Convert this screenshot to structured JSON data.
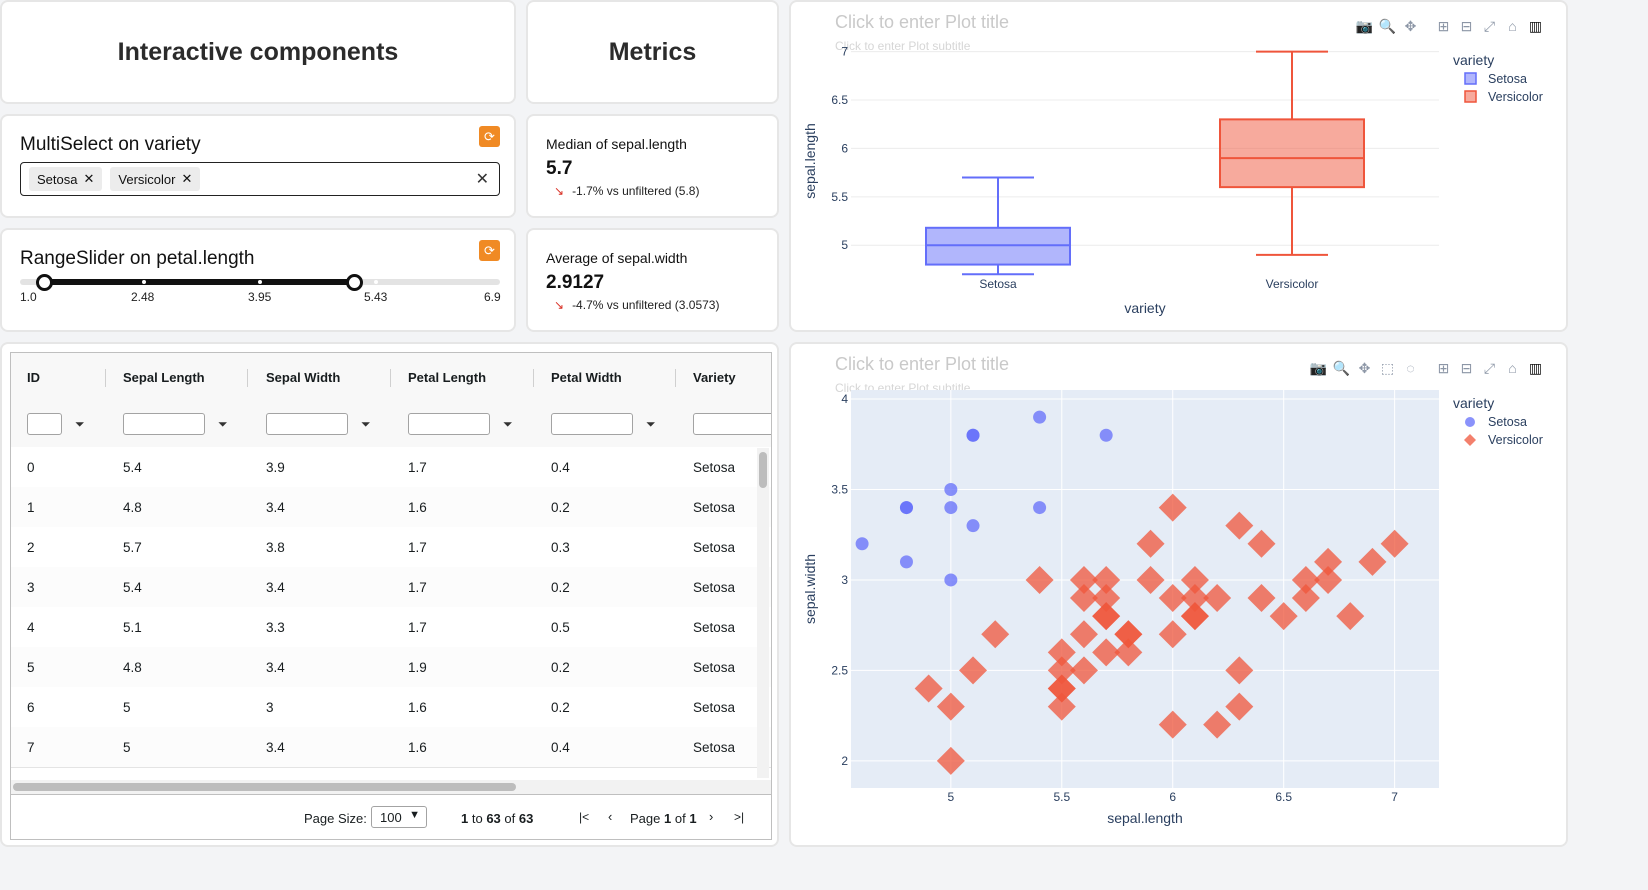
{
  "headers": {
    "interactive": "Interactive components",
    "metrics": "Metrics"
  },
  "multiselect": {
    "title": "MultiSelect on variety",
    "chips": [
      "Setosa",
      "Versicolor"
    ]
  },
  "rangeslider": {
    "title": "RangeSlider on petal.length",
    "min": 1.0,
    "max": 6.9,
    "value": [
      1.3,
      5.1
    ],
    "labels": [
      "1.0",
      "2.48",
      "3.95",
      "5.43",
      "6.9"
    ]
  },
  "metric1": {
    "label": "Median of sepal.length",
    "value": "5.7",
    "delta": "-1.7% vs unfiltered (5.8)"
  },
  "metric2": {
    "label": "Average of sepal.width",
    "value": "2.9127",
    "delta": "-4.7% vs unfiltered (3.0573)"
  },
  "table": {
    "columns": [
      "ID",
      "Sepal Length",
      "Sepal Width",
      "Petal Length",
      "Petal Width",
      "Variety"
    ],
    "rows": [
      [
        "0",
        "5.4",
        "3.9",
        "1.7",
        "0.4",
        "Setosa"
      ],
      [
        "1",
        "4.8",
        "3.4",
        "1.6",
        "0.2",
        "Setosa"
      ],
      [
        "2",
        "5.7",
        "3.8",
        "1.7",
        "0.3",
        "Setosa"
      ],
      [
        "3",
        "5.4",
        "3.4",
        "1.7",
        "0.2",
        "Setosa"
      ],
      [
        "4",
        "5.1",
        "3.3",
        "1.7",
        "0.5",
        "Setosa"
      ],
      [
        "5",
        "4.8",
        "3.4",
        "1.9",
        "0.2",
        "Setosa"
      ],
      [
        "6",
        "5",
        "3",
        "1.6",
        "0.2",
        "Setosa"
      ],
      [
        "7",
        "5",
        "3.4",
        "1.6",
        "0.4",
        "Setosa"
      ]
    ],
    "page_size_label": "Page Size:",
    "page_size": "100",
    "range_from": "1",
    "range_to_word": "to",
    "range_to": "63",
    "of_word": "of",
    "total": "63",
    "page_word": "Page",
    "page": "1",
    "pages": "1"
  },
  "plot_placeholders": {
    "title": "Click to enter Plot title",
    "subtitle": "Click to enter Plot subtitle"
  },
  "chart_data": [
    {
      "type": "box",
      "xlabel": "variety",
      "ylabel": "sepal.length",
      "legend_title": "variety",
      "legend_position": "top-right",
      "ylim": [
        4.62,
        7.12
      ],
      "yticks": [
        5,
        5.5,
        6,
        6.5,
        7
      ],
      "series": [
        {
          "name": "Setosa",
          "color": "#636efa",
          "min": 4.7,
          "q1": 4.8,
          "median": 5.0,
          "q3": 5.18,
          "max": 5.7
        },
        {
          "name": "Versicolor",
          "color": "#ef553b",
          "min": 4.9,
          "q1": 5.6,
          "median": 5.9,
          "q3": 6.3,
          "max": 7.0
        }
      ]
    },
    {
      "type": "scatter",
      "xlabel": "sepal.length",
      "ylabel": "sepal.width",
      "legend_title": "variety",
      "legend_position": "top-right",
      "xlim": [
        4.55,
        7.2
      ],
      "ylim": [
        1.85,
        4.05
      ],
      "xticks": [
        5,
        5.5,
        6,
        6.5,
        7
      ],
      "yticks": [
        2,
        2.5,
        3,
        3.5,
        4
      ],
      "series": [
        {
          "name": "Setosa",
          "color": "#636efa",
          "marker": "circle",
          "points": [
            [
              4.6,
              3.2
            ],
            [
              4.8,
              3.4
            ],
            [
              4.8,
              3.4
            ],
            [
              4.8,
              3.1
            ],
            [
              5.0,
              3.5
            ],
            [
              5.0,
              3.4
            ],
            [
              5.0,
              3.0
            ],
            [
              5.1,
              3.8
            ],
            [
              5.1,
              3.8
            ],
            [
              5.1,
              3.3
            ],
            [
              5.4,
              3.9
            ],
            [
              5.4,
              3.4
            ],
            [
              5.7,
              3.8
            ]
          ]
        },
        {
          "name": "Versicolor",
          "color": "#ef553b",
          "marker": "diamond",
          "points": [
            [
              4.9,
              2.4
            ],
            [
              5.0,
              2.3
            ],
            [
              5.0,
              2.0
            ],
            [
              5.1,
              2.5
            ],
            [
              5.2,
              2.7
            ],
            [
              5.4,
              3.0
            ],
            [
              5.5,
              2.6
            ],
            [
              5.5,
              2.5
            ],
            [
              5.5,
              2.4
            ],
            [
              5.5,
              2.4
            ],
            [
              5.5,
              2.3
            ],
            [
              5.6,
              3.0
            ],
            [
              5.6,
              2.9
            ],
            [
              5.6,
              2.7
            ],
            [
              5.6,
              2.5
            ],
            [
              5.7,
              3.0
            ],
            [
              5.7,
              2.9
            ],
            [
              5.7,
              2.8
            ],
            [
              5.7,
              2.8
            ],
            [
              5.7,
              2.6
            ],
            [
              5.8,
              2.7
            ],
            [
              5.8,
              2.7
            ],
            [
              5.8,
              2.6
            ],
            [
              5.9,
              3.2
            ],
            [
              5.9,
              3.0
            ],
            [
              6.0,
              3.4
            ],
            [
              6.0,
              2.9
            ],
            [
              6.0,
              2.7
            ],
            [
              6.0,
              2.2
            ],
            [
              6.1,
              3.0
            ],
            [
              6.1,
              2.9
            ],
            [
              6.1,
              2.8
            ],
            [
              6.1,
              2.8
            ],
            [
              6.2,
              2.9
            ],
            [
              6.2,
              2.2
            ],
            [
              6.3,
              3.3
            ],
            [
              6.3,
              2.5
            ],
            [
              6.3,
              2.3
            ],
            [
              6.4,
              3.2
            ],
            [
              6.4,
              2.9
            ],
            [
              6.5,
              2.8
            ],
            [
              6.6,
              3.0
            ],
            [
              6.6,
              2.9
            ],
            [
              6.7,
              3.1
            ],
            [
              6.7,
              3.0
            ],
            [
              6.8,
              2.8
            ],
            [
              6.9,
              3.1
            ],
            [
              7.0,
              3.2
            ]
          ]
        }
      ]
    }
  ]
}
